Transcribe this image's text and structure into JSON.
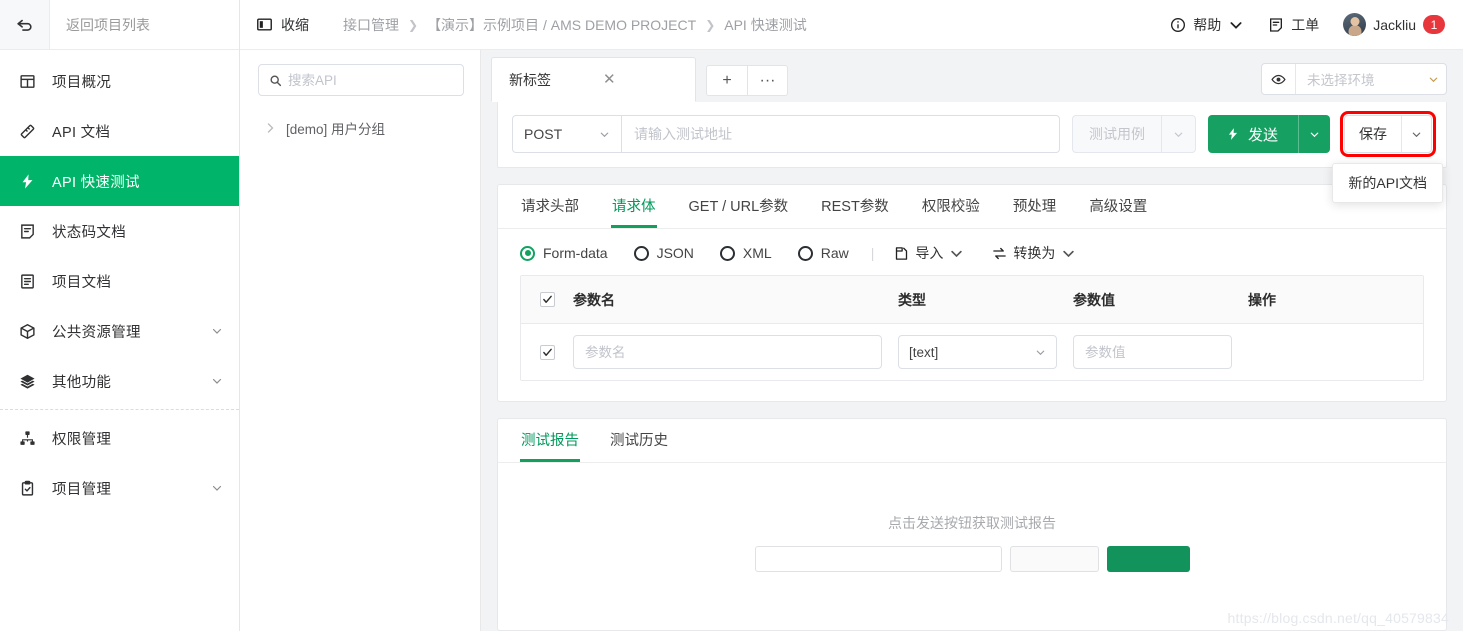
{
  "sidebar": {
    "back_label": "返回项目列表",
    "items": [
      {
        "label": "项目概况",
        "icon": "dashboard-icon",
        "expandable": false,
        "active": false
      },
      {
        "label": "API 文档",
        "icon": "api-doc-icon",
        "expandable": false,
        "active": false
      },
      {
        "label": "API 快速测试",
        "icon": "lightning-icon",
        "expandable": false,
        "active": true
      },
      {
        "label": "状态码文档",
        "icon": "status-code-icon",
        "expandable": false,
        "active": false
      },
      {
        "label": "项目文档",
        "icon": "project-doc-icon",
        "expandable": false,
        "active": false
      },
      {
        "label": "公共资源管理",
        "icon": "cube-icon",
        "expandable": true,
        "active": false
      },
      {
        "label": "其他功能",
        "icon": "layers-icon",
        "expandable": true,
        "active": false
      },
      {
        "label": "权限管理",
        "icon": "sitemap-icon",
        "expandable": false,
        "active": false,
        "divider_before": true
      },
      {
        "label": "项目管理",
        "icon": "clipboard-check-icon",
        "expandable": true,
        "active": false
      }
    ]
  },
  "topbar": {
    "collapse_label": "收缩",
    "breadcrumbs": [
      "接口管理",
      "【演示】示例项目 / AMS DEMO PROJECT",
      "API 快速测试"
    ],
    "help_label": "帮助",
    "ticket_label": "工单",
    "user_name": "Jackliu",
    "notification_count": "1"
  },
  "tree": {
    "search_placeholder": "搜索API",
    "search_value": "",
    "nodes": [
      {
        "label": "[demo] 用户分组",
        "expanded": false
      }
    ]
  },
  "tabs": {
    "items": [
      {
        "label": "新标签",
        "active": true
      }
    ],
    "add_label": "+",
    "more_label": "···"
  },
  "environment": {
    "placeholder": "未选择环境",
    "value": ""
  },
  "request": {
    "method": "POST",
    "url_placeholder": "请输入测试地址",
    "url_value": "",
    "testcase_label": "测试用例",
    "send_label": "发送",
    "save_label": "保存",
    "save_menu": [
      "新的API文档"
    ]
  },
  "request_tabs": [
    {
      "label": "请求头部",
      "active": false
    },
    {
      "label": "请求体",
      "active": true
    },
    {
      "label": "GET / URL参数",
      "active": false
    },
    {
      "label": "REST参数",
      "active": false
    },
    {
      "label": "权限校验",
      "active": false
    },
    {
      "label": "预处理",
      "active": false
    },
    {
      "label": "高级设置",
      "active": false
    }
  ],
  "body_format": {
    "options": [
      {
        "label": "Form-data",
        "selected": true
      },
      {
        "label": "JSON",
        "selected": false
      },
      {
        "label": "XML",
        "selected": false
      },
      {
        "label": "Raw",
        "selected": false
      }
    ],
    "import_label": "导入",
    "convert_label": "转换为"
  },
  "param_table": {
    "headers": [
      "参数名",
      "类型",
      "参数值",
      "操作"
    ],
    "rows": [
      {
        "checked": true,
        "name_placeholder": "参数名",
        "name_value": "",
        "type_value": "[text]",
        "value_placeholder": "参数值",
        "value_value": "",
        "operation": ""
      }
    ]
  },
  "report": {
    "tabs": [
      {
        "label": "测试报告",
        "active": true
      },
      {
        "label": "测试历史",
        "active": false
      }
    ],
    "empty_text": "点击发送按钮获取测试报告"
  },
  "watermark": "https://blog.csdn.net/qq_40579834",
  "colors": {
    "accent_green": "#00b569",
    "send_green": "#16a163",
    "highlight_red": "#ff0000",
    "badge_red": "#e8363d"
  }
}
